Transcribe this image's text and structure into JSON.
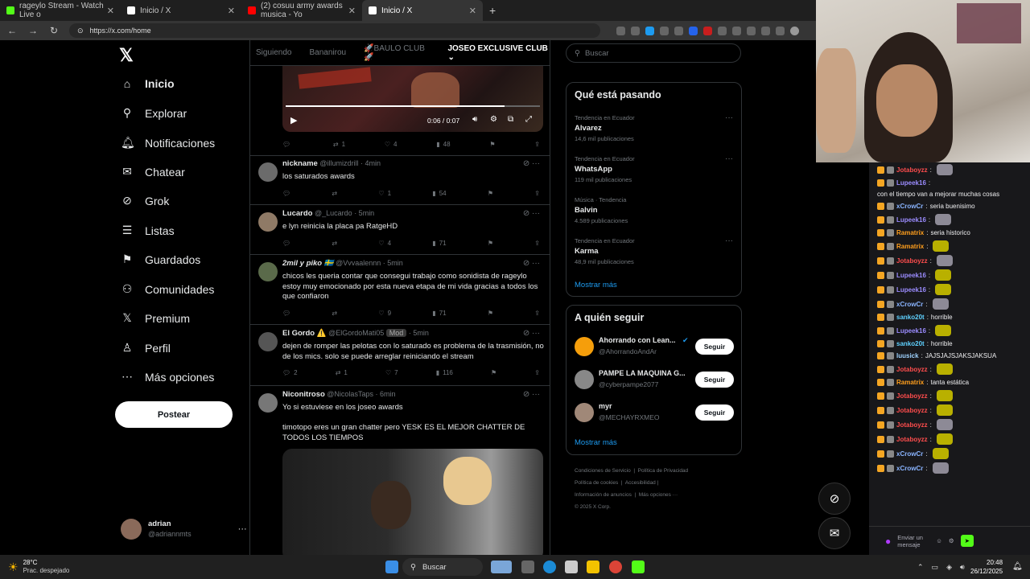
{
  "browser": {
    "tabs": [
      {
        "label": "rageylo Stream - Watch Live o",
        "color": "#53fc18"
      },
      {
        "label": "Inicio / X",
        "color": "#ffffff"
      },
      {
        "label": "(2) cosuu army awards musica - Yo",
        "color": "#ff0000"
      },
      {
        "label": "Inicio / X",
        "color": "#ffffff"
      }
    ],
    "url": "https://x.com/home"
  },
  "sidebar": {
    "items": [
      {
        "label": "Inicio",
        "icon": "⌂"
      },
      {
        "label": "Explorar",
        "icon": "⚲"
      },
      {
        "label": "Notificaciones",
        "icon": "🔔︎"
      },
      {
        "label": "Chatear",
        "icon": "✉"
      },
      {
        "label": "Grok",
        "icon": "⊘"
      },
      {
        "label": "Listas",
        "icon": "☰"
      },
      {
        "label": "Guardados",
        "icon": "⚑"
      },
      {
        "label": "Comunidades",
        "icon": "⚇"
      },
      {
        "label": "Premium",
        "icon": "𝕏"
      },
      {
        "label": "Perfil",
        "icon": "♙"
      },
      {
        "label": "Más opciones",
        "icon": "⋯"
      }
    ],
    "post_button": "Postear",
    "account": {
      "name": "adrian",
      "handle": "@adriannmts"
    }
  },
  "feed": {
    "tabs": [
      "Siguiendo",
      "Bananirou",
      "🚀BAULO CLUB🚀",
      "JOSEO EXCLUSIVE CLUB"
    ],
    "video": {
      "time": "0:06 / 0:07",
      "progress": 0.86
    },
    "first_actions": {
      "replies": "",
      "reposts": "1",
      "likes": "4",
      "views": "48"
    },
    "posts": [
      {
        "name": "nickname",
        "handle": "@illumizdrill",
        "time": "· 4min",
        "text": "los saturados awards",
        "replies": "",
        "reposts": "",
        "likes": "1",
        "views": "54"
      },
      {
        "name": "Lucardo",
        "handle": "@_Lucardo",
        "time": "· 5min",
        "text": "e lyn reinicia la placa pa RatgeHD",
        "replies": "",
        "reposts": "",
        "likes": "4",
        "views": "71"
      },
      {
        "name": "2mil y piko 🇸🇪",
        "handle": "@Vvvaalennn",
        "time": "· 5min",
        "text": "chicos les queria contar que consegui trabajo como sonidista de rageylo estoy muy emocionado por esta nueva etapa de mi vida gracias a todos los que confiaron",
        "replies": "",
        "reposts": "",
        "likes": "9",
        "views": "71"
      },
      {
        "name": "El Gordo ⚠️",
        "handle": "@ElGordoMati05",
        "time": "· 5min",
        "text": "dejen de romper las pelotas con lo saturado es problema de la trasmisión, no de los mics. solo se puede arreglar reiniciando el stream",
        "replies": "2",
        "reposts": "1",
        "likes": "7",
        "views": "116"
      },
      {
        "name": "Niconitroso",
        "handle": "@NicolasTaps",
        "time": "· 6min",
        "text": "Yo si estuviese en los joseo awards\n\ntimotopo eres un gran chatter pero YESK ES EL MEJOR CHATTER DE TODOS LOS TIEMPOS"
      }
    ],
    "mod_tag": "Mod"
  },
  "right": {
    "search_placeholder": "Buscar",
    "trends_title": "Qué está pasando",
    "trends": [
      {
        "context": "Tendencia en Ecuador",
        "name": "Alvarez",
        "count": "14,6 mil publicaciones"
      },
      {
        "context": "Tendencia en Ecuador",
        "name": "WhatsApp",
        "count": "119 mil publicaciones"
      },
      {
        "context": "Música · Tendencia",
        "name": "Balvin",
        "count": "4.589 publicaciones"
      },
      {
        "context": "Tendencia en Ecuador",
        "name": "Karma",
        "count": "48,9 mil publicaciones"
      }
    ],
    "show_more": "Mostrar más",
    "follow_title": "A quién seguir",
    "follow": [
      {
        "name": "Ahorrando con Lean...",
        "handle": "@AhorrandoAndAr",
        "button": "Seguir"
      },
      {
        "name": "PAMPE LA MAQUINA G...",
        "handle": "@cyberpampe2077",
        "button": "Seguir"
      },
      {
        "name": "myr",
        "handle": "@MECHAYRXMEO",
        "button": "Seguir"
      }
    ],
    "footer": [
      "Condiciones de Servicio",
      "Política de Privacidad",
      "Política de cookies",
      "Accesibilidad",
      "Información de anuncios",
      "Más opciones ···",
      "© 2025 X Corp."
    ]
  },
  "chat": {
    "messages": [
      {
        "user": "Jotaboyzz",
        "color": "#ff4d4d",
        "text": ""
      },
      {
        "user": "Lupeek16",
        "color": "#9b8cff",
        "text": "con el tiempo van a mejorar muchas cosas"
      },
      {
        "user": "xCrowCr",
        "color": "#8ab4ff",
        "text": "seria buenisimo"
      },
      {
        "user": "Lupeek16",
        "color": "#9b8cff",
        "text": ""
      },
      {
        "user": "Ramatrix",
        "color": "#ff9f1c",
        "text": "seria historico"
      },
      {
        "user": "Ramatrix",
        "color": "#ff9f1c",
        "text": ""
      },
      {
        "user": "Jotaboyzz",
        "color": "#ff4d4d",
        "text": ""
      },
      {
        "user": "Lupeek16",
        "color": "#9b8cff",
        "text": ""
      },
      {
        "user": "Lupeek16",
        "color": "#9b8cff",
        "text": ""
      },
      {
        "user": "xCrowCr",
        "color": "#8ab4ff",
        "text": ""
      },
      {
        "user": "sanko20t",
        "color": "#5fd1ff",
        "text": "horrible"
      },
      {
        "user": "Lupeek16",
        "color": "#9b8cff",
        "text": ""
      },
      {
        "user": "sanko20t",
        "color": "#5fd1ff",
        "text": "horrible"
      },
      {
        "user": "luusick",
        "color": "#9fd3ff",
        "text": "JAJSJAJSJAKSJAKSUA"
      },
      {
        "user": "Jotaboyzz",
        "color": "#ff4d4d",
        "text": ""
      },
      {
        "user": "Ramatrix",
        "color": "#ff9f1c",
        "text": "tanta estática"
      },
      {
        "user": "Jotaboyzz",
        "color": "#ff4d4d",
        "text": ""
      },
      {
        "user": "Jotaboyzz",
        "color": "#ff4d4d",
        "text": ""
      },
      {
        "user": "Jotaboyzz",
        "color": "#ff4d4d",
        "text": ""
      },
      {
        "user": "Jotaboyzz",
        "color": "#ff4d4d",
        "text": ""
      },
      {
        "user": "xCrowCr",
        "color": "#8ab4ff",
        "text": ""
      },
      {
        "user": "xCrowCr",
        "color": "#8ab4ff",
        "text": ""
      }
    ],
    "send_label": "Enviar un mensaje"
  },
  "taskbar": {
    "weather_temp": "28°C",
    "weather_desc": "Prac. despejado",
    "search": "Buscar",
    "time": "20:48",
    "date": "26/12/2025"
  }
}
